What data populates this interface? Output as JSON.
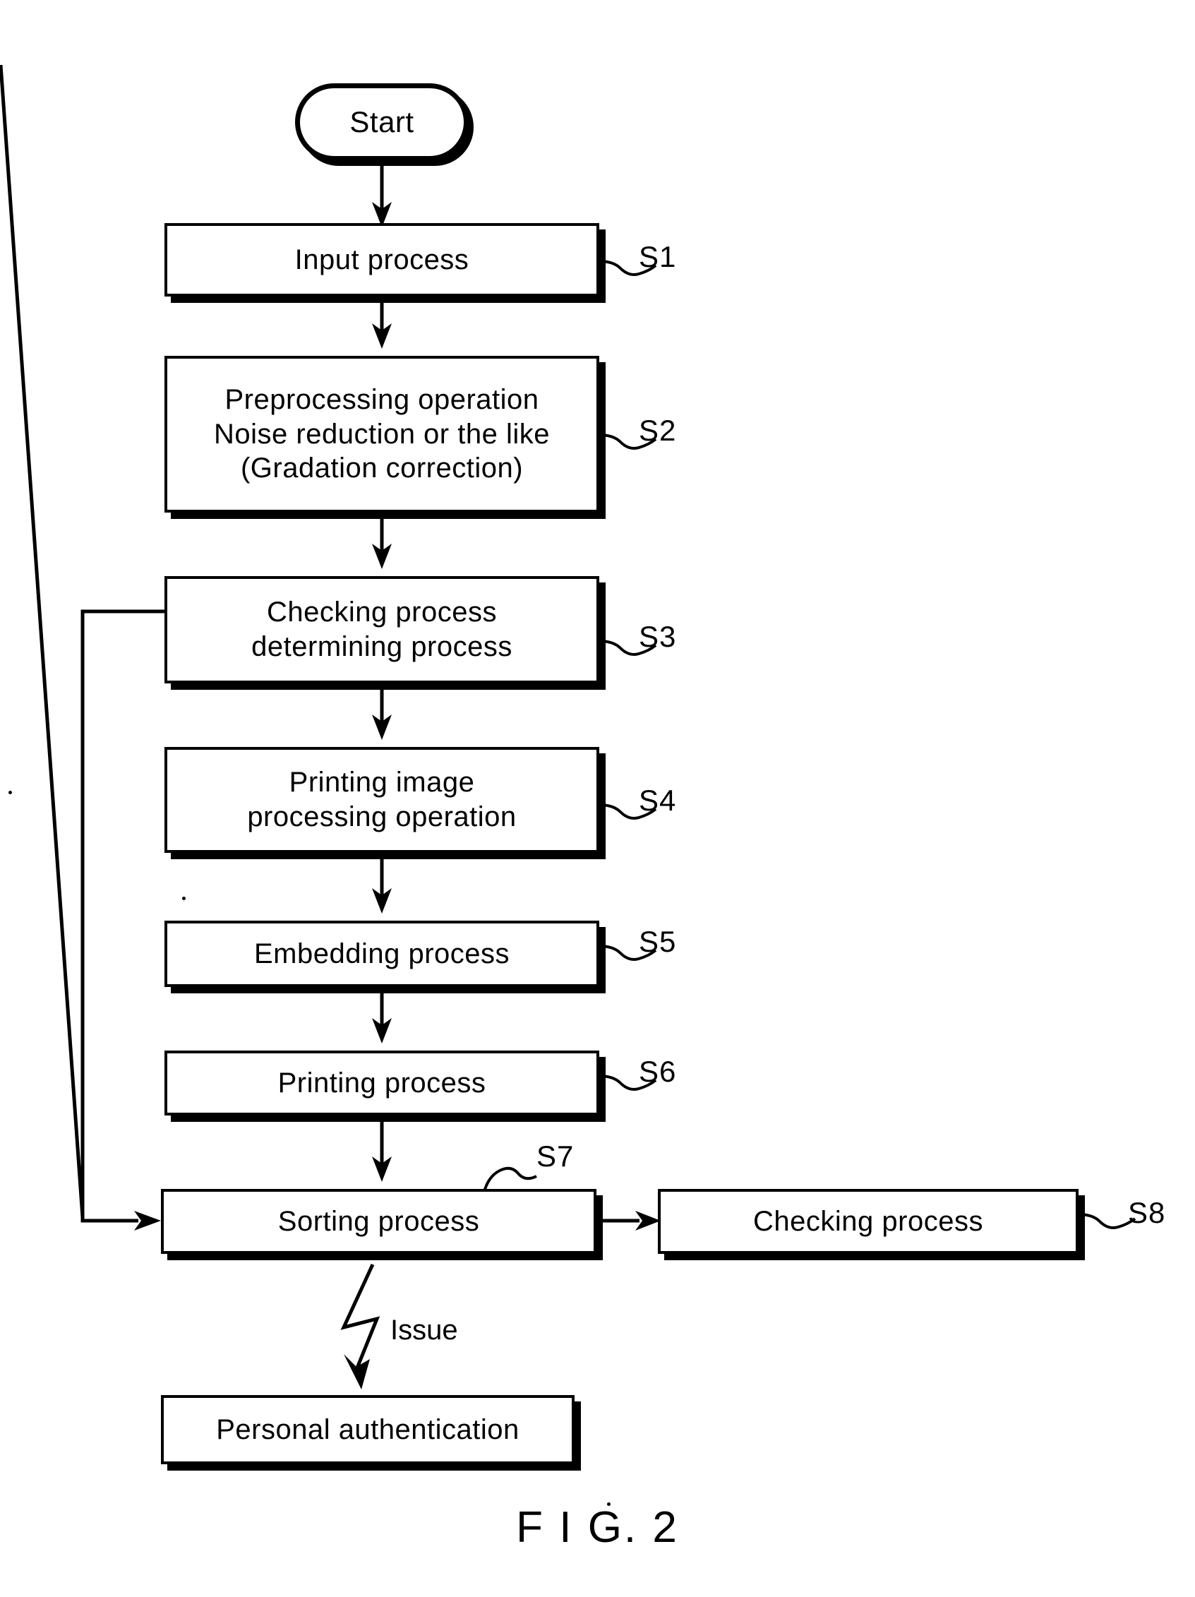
{
  "figure": {
    "caption": "F I G. 2"
  },
  "nodes": {
    "start": {
      "label": "Start",
      "shape": "terminator"
    },
    "s1": {
      "label": "Input process",
      "step": "S1"
    },
    "s2": {
      "label": "Preprocessing operation\nNoise reduction  or  the  like\n(Gradation  correction)",
      "step": "S2"
    },
    "s3": {
      "label": "Checking  process\ndetermining  process",
      "step": "S3"
    },
    "s4": {
      "label": "Printing  image\nprocessing  operation",
      "step": "S4"
    },
    "s5": {
      "label": "Embedding  process",
      "step": "S5"
    },
    "s6": {
      "label": "Printing  process",
      "step": "S6"
    },
    "s7": {
      "label": "Sorting  process",
      "step": "S7"
    },
    "s8": {
      "label": "Checking  process",
      "step": "S8"
    },
    "personal_authentication": {
      "label": "Personal  authentication"
    }
  },
  "edges": {
    "issue_label": "Issue"
  },
  "colors": {
    "ink": "#000000",
    "paper": "#ffffff"
  }
}
